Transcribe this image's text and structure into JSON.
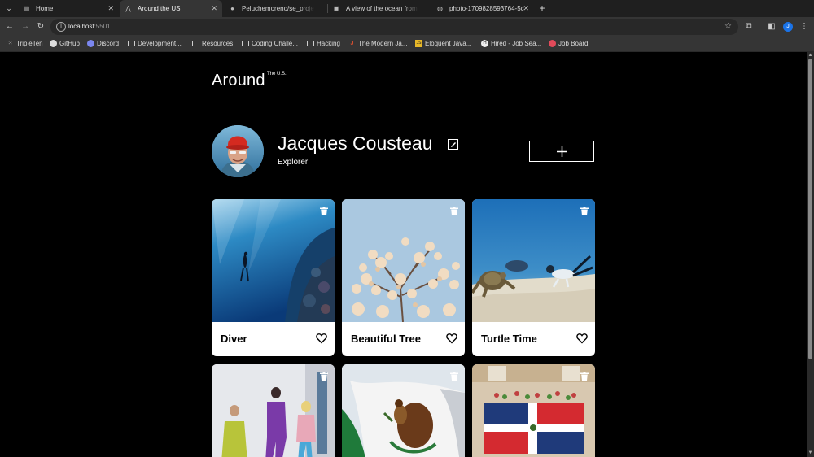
{
  "browser": {
    "tabs": [
      {
        "title": "Home",
        "icon": "page-icon"
      },
      {
        "title": "Around the US",
        "icon": "logo-icon",
        "active": true
      },
      {
        "title": "Peluchemoreno/se_proje",
        "icon": "github-icon"
      },
      {
        "title": "A view of the ocean from",
        "icon": "unsplash-icon"
      },
      {
        "title": "photo-1709828593764-5c",
        "icon": "globe-icon"
      }
    ],
    "new_tab": "+",
    "url_host": "localhost",
    "url_port": ":5501",
    "profile_initial": "J",
    "bookmarks": [
      {
        "label": "TripleTen",
        "icon": "grid-icon"
      },
      {
        "label": "GitHub",
        "icon": "github-icon"
      },
      {
        "label": "Discord",
        "icon": "discord-icon"
      },
      {
        "label": "Development...",
        "icon": "folder-icon"
      },
      {
        "label": "Resources",
        "icon": "folder-icon"
      },
      {
        "label": "Coding Challe...",
        "icon": "folder-icon"
      },
      {
        "label": "Hacking",
        "icon": "folder-icon"
      },
      {
        "label": "The Modern Ja...",
        "icon": "javascript-icon"
      },
      {
        "label": "Eloquent Java...",
        "icon": "js-book-icon"
      },
      {
        "label": "Hired - Job Sea...",
        "icon": "hired-icon"
      },
      {
        "label": "Job Board",
        "icon": "jobboard-icon"
      }
    ]
  },
  "header": {
    "logo": "Around",
    "logo_sup": "The U.S."
  },
  "profile": {
    "name": "Jacques Cousteau",
    "job": "Explorer"
  },
  "cards": [
    {
      "title": "Diver"
    },
    {
      "title": "Beautiful Tree"
    },
    {
      "title": "Turtle Time"
    },
    {
      "title": ""
    },
    {
      "title": ""
    },
    {
      "title": ""
    }
  ]
}
